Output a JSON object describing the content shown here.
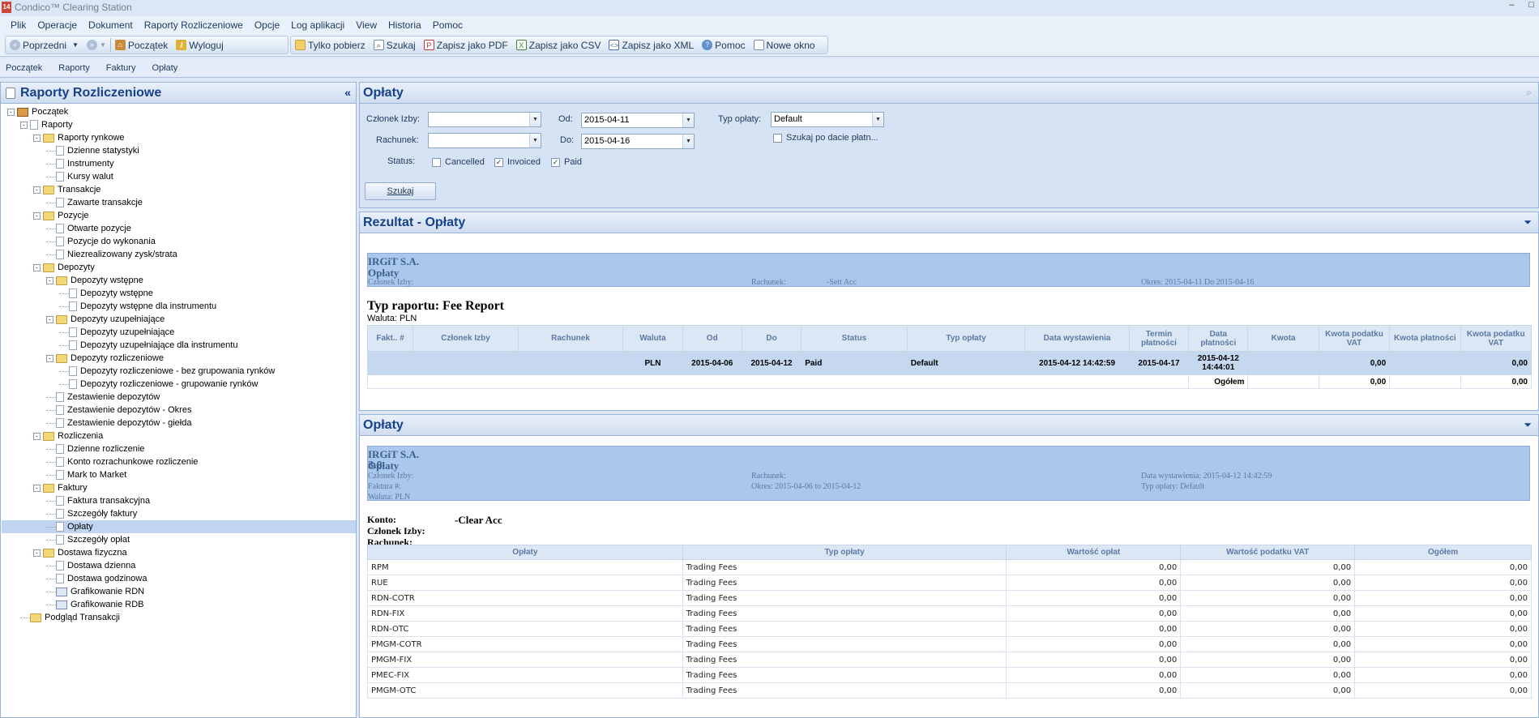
{
  "window": {
    "title": "Condico™ Clearing Station",
    "app_icon": "14",
    "controls": [
      "–",
      "□"
    ]
  },
  "menu": [
    "Plik",
    "Operacje",
    "Dokument",
    "Raporty Rozliczeniowe",
    "Opcje",
    "Log aplikacji",
    "View",
    "Historia",
    "Pomoc"
  ],
  "toolbar": {
    "back": "Poprzedni",
    "home": "Początek",
    "logout": "Wyloguj",
    "fetch_only": "Tylko pobierz",
    "search": "Szukaj",
    "save_pdf": "Zapisz jako PDF",
    "save_csv": "Zapisz jako CSV",
    "save_xml": "Zapisz jako XML",
    "help": "Pomoc",
    "new_window": "Nowe okno"
  },
  "breadcrumb": [
    "Początek",
    "Raporty",
    "Faktury",
    "Opłaty"
  ],
  "left_panel": {
    "title": "Raporty Rozliczeniowe",
    "collapse": "«",
    "tree": [
      {
        "label": "Początek",
        "level": 0,
        "icon": "home",
        "toggle": "-"
      },
      {
        "label": "Raporty",
        "level": 1,
        "icon": "doc",
        "toggle": "-"
      },
      {
        "label": "Raporty rynkowe",
        "level": 2,
        "icon": "folder",
        "toggle": "-"
      },
      {
        "label": "Dzienne statystyki",
        "level": 3,
        "icon": "doc"
      },
      {
        "label": "Instrumenty",
        "level": 3,
        "icon": "doc"
      },
      {
        "label": "Kursy walut",
        "level": 3,
        "icon": "doc"
      },
      {
        "label": "Transakcje",
        "level": 2,
        "icon": "folder",
        "toggle": "-"
      },
      {
        "label": "Zawarte transakcje",
        "level": 3,
        "icon": "doc"
      },
      {
        "label": "Pozycje",
        "level": 2,
        "icon": "folder",
        "toggle": "-"
      },
      {
        "label": "Otwarte pozycje",
        "level": 3,
        "icon": "doc"
      },
      {
        "label": "Pozycje do wykonania",
        "level": 3,
        "icon": "doc"
      },
      {
        "label": "Niezrealizowany zysk/strata",
        "level": 3,
        "icon": "doc"
      },
      {
        "label": "Depozyty",
        "level": 2,
        "icon": "folder",
        "toggle": "-"
      },
      {
        "label": "Depozyty wstępne",
        "level": 3,
        "icon": "folder",
        "toggle": "-"
      },
      {
        "label": "Depozyty wstępne",
        "level": 4,
        "icon": "doc"
      },
      {
        "label": "Depozyty wstępne dla instrumentu",
        "level": 4,
        "icon": "doc"
      },
      {
        "label": "Depozyty uzupełniające",
        "level": 3,
        "icon": "folder",
        "toggle": "-"
      },
      {
        "label": "Depozyty uzupełniające",
        "level": 4,
        "icon": "doc"
      },
      {
        "label": "Depozyty uzupełniające dla instrumentu",
        "level": 4,
        "icon": "doc"
      },
      {
        "label": "Depozyty rozliczeniowe",
        "level": 3,
        "icon": "folder",
        "toggle": "-"
      },
      {
        "label": "Depozyty rozliczeniowe - bez grupowania rynków",
        "level": 4,
        "icon": "doc"
      },
      {
        "label": "Depozyty rozliczeniowe - grupowanie rynków",
        "level": 4,
        "icon": "doc"
      },
      {
        "label": "Zestawienie depozytów",
        "level": 3,
        "icon": "doc"
      },
      {
        "label": "Zestawienie depozytów - Okres",
        "level": 3,
        "icon": "doc"
      },
      {
        "label": "Zestawienie depozytów - giełda",
        "level": 3,
        "icon": "doc"
      },
      {
        "label": "Rozliczenia",
        "level": 2,
        "icon": "folder",
        "toggle": "-"
      },
      {
        "label": "Dzienne rozliczenie",
        "level": 3,
        "icon": "doc"
      },
      {
        "label": "Konto rozrachunkowe rozliczenie",
        "level": 3,
        "icon": "doc"
      },
      {
        "label": "Mark to Market",
        "level": 3,
        "icon": "doc"
      },
      {
        "label": "Faktury",
        "level": 2,
        "icon": "folder",
        "toggle": "-"
      },
      {
        "label": "Faktura transakcyjna",
        "level": 3,
        "icon": "doc"
      },
      {
        "label": "Szczegóły faktury",
        "level": 3,
        "icon": "doc"
      },
      {
        "label": "Opłaty",
        "level": 3,
        "icon": "doc",
        "selected": true
      },
      {
        "label": "Szczegóły opłat",
        "level": 3,
        "icon": "doc"
      },
      {
        "label": "Dostawa fizyczna",
        "level": 2,
        "icon": "folder",
        "toggle": "-"
      },
      {
        "label": "Dostawa dzienna",
        "level": 3,
        "icon": "doc"
      },
      {
        "label": "Dostawa godzinowa",
        "level": 3,
        "icon": "doc"
      },
      {
        "label": "Grafikowanie RDN",
        "level": 3,
        "icon": "chart"
      },
      {
        "label": "Grafikowanie RDB",
        "level": 3,
        "icon": "chart"
      },
      {
        "label": "Podgląd Transakcji",
        "level": 1,
        "icon": "folder"
      }
    ]
  },
  "search_pane": {
    "title": "Opłaty",
    "member_label": "Członek Izby:",
    "member_value": "",
    "account_label": "Rachunek:",
    "account_value": "",
    "from_label": "Od:",
    "from_value": "2015-04-11",
    "to_label": "Do:",
    "to_value": "2015-04-16",
    "fee_type_label": "Typ opłaty:",
    "fee_type_value": "Default",
    "pay_date_label": "Szukaj po dacie płatn...",
    "status_label": "Status:",
    "statuses": [
      {
        "label": "Cancelled",
        "checked": false
      },
      {
        "label": "Invoiced",
        "checked": true
      },
      {
        "label": "Paid",
        "checked": true
      }
    ],
    "check_mark": "✓",
    "search_button": "Szukaj"
  },
  "result_pane": {
    "title": "Rezultat - Opłaty",
    "company": "IRGiT S.A.",
    "subtitle": "Opłaty",
    "member_label": "Członek Izby:",
    "account_label": "Rachunek:",
    "account_value": "-Sett Acc",
    "period": "Okres: 2015-04-11 Do 2015-04-16",
    "report_type": "Typ raportu: Fee Report",
    "currency": "Waluta: PLN",
    "headers": [
      "Fakt.. #",
      "Członek Izby",
      "Rachunek",
      "Waluta",
      "Od",
      "Do",
      "Status",
      "Typ opłaty",
      "Data wystawienia",
      "Termin płatności",
      "Data płatności",
      "Kwota",
      "Kwota podatku VAT",
      "Kwota płatności",
      "Kwota podatku VAT"
    ],
    "row": [
      "",
      "",
      "",
      "PLN",
      "2015-04-06",
      "2015-04-12",
      "Paid",
      "Default",
      "2015-04-12 14:42:59",
      "2015-04-17",
      "2015-04-12 14:44:01",
      "",
      "0,00",
      "",
      "0,00"
    ],
    "total_label": "Ogółem",
    "total_vat": "0,00",
    "total_vat2": "0,00"
  },
  "detail_pane": {
    "title": "Opłaty",
    "company": "IRGiT S.A.",
    "subtitle": "Opłaty",
    "version": "3.0",
    "member_label": "Członek Izby:",
    "invoice_label": "Faktura #:",
    "currency_label": "Waluta: PLN",
    "account_label": "Rachunek:",
    "period": "Okres: 2015-04-06 to 2015-04-12",
    "issue_date": "Data wystawienia: 2015-04-12 14:42:59",
    "fee_type": "Typ opłaty: Default",
    "konto_label": "Konto:",
    "konto_value": "-Clear Acc",
    "member2_label": "Członek Izby:",
    "account2_label": "Rachunek:",
    "headers": [
      "Opłaty",
      "Typ opłaty",
      "Wartość opłat",
      "Wartość podatku VAT",
      "Ogółem"
    ],
    "rows": [
      [
        "RPM",
        "Trading Fees",
        "0,00",
        "0,00",
        "0,00"
      ],
      [
        "RUE",
        "Trading Fees",
        "0,00",
        "0,00",
        "0,00"
      ],
      [
        "RDN-COTR",
        "Trading Fees",
        "0,00",
        "0,00",
        "0,00"
      ],
      [
        "RDN-FIX",
        "Trading Fees",
        "0,00",
        "0,00",
        "0,00"
      ],
      [
        "RDN-OTC",
        "Trading Fees",
        "0,00",
        "0,00",
        "0,00"
      ],
      [
        "PMGM-COTR",
        "Trading Fees",
        "0,00",
        "0,00",
        "0,00"
      ],
      [
        "PMGM-FIX",
        "Trading Fees",
        "0,00",
        "0,00",
        "0,00"
      ],
      [
        "PMEC-FIX",
        "Trading Fees",
        "0,00",
        "0,00",
        "0,00"
      ],
      [
        "PMGM-OTC",
        "Trading Fees",
        "0,00",
        "0,00",
        "0,00"
      ]
    ]
  }
}
